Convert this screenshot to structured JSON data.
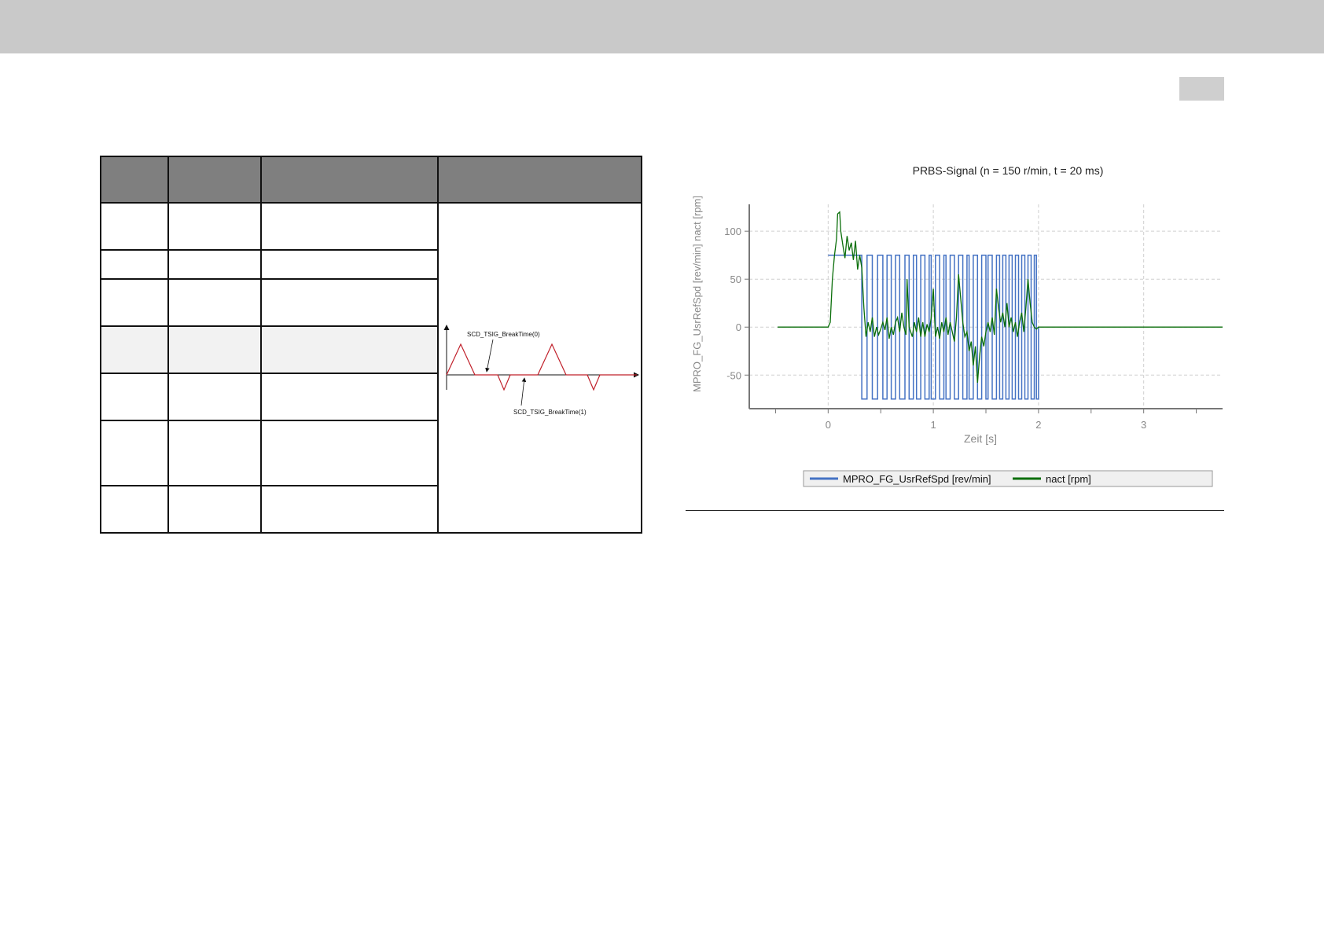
{
  "figure_labels": {
    "tsig_break_0": "SCD_TSIG_BreakTime(0)",
    "tsig_break_1": "SCD_TSIG_BreakTime(1)"
  },
  "chart_data": {
    "type": "line",
    "title": "PRBS-Signal (n = 150 r/min, t = 20 ms)",
    "xlabel": "Zeit [s]",
    "ylabel": "MPRO_FG_UsrRefSpd [rev/min]  nact [rpm]",
    "xlim": [
      -0.75,
      3.75
    ],
    "ylim": [
      -85,
      128
    ],
    "x_ticks": [
      0,
      1,
      2,
      3
    ],
    "y_ticks": [
      100,
      50,
      0,
      -50
    ],
    "grid": true,
    "legend_position": "bottom",
    "series": [
      {
        "name": "MPRO_FG_UsrRefSpd [rev/min]",
        "color": "#4472c4",
        "points": [
          [
            0,
            75
          ],
          [
            0.32,
            75
          ],
          [
            0.32,
            -75
          ],
          [
            0.37,
            -75
          ],
          [
            0.37,
            75
          ],
          [
            0.42,
            75
          ],
          [
            0.42,
            -75
          ],
          [
            0.47,
            -75
          ],
          [
            0.47,
            75
          ],
          [
            0.52,
            75
          ],
          [
            0.52,
            -75
          ],
          [
            0.56,
            -75
          ],
          [
            0.56,
            75
          ],
          [
            0.6,
            75
          ],
          [
            0.6,
            -75
          ],
          [
            0.64,
            -75
          ],
          [
            0.64,
            75
          ],
          [
            0.68,
            75
          ],
          [
            0.68,
            -75
          ],
          [
            0.73,
            -75
          ],
          [
            0.73,
            75
          ],
          [
            0.77,
            75
          ],
          [
            0.77,
            -75
          ],
          [
            0.81,
            -75
          ],
          [
            0.81,
            75
          ],
          [
            0.84,
            75
          ],
          [
            0.84,
            -75
          ],
          [
            0.88,
            -75
          ],
          [
            0.88,
            75
          ],
          [
            0.92,
            75
          ],
          [
            0.92,
            -75
          ],
          [
            0.96,
            -75
          ],
          [
            0.96,
            75
          ],
          [
            0.98,
            75
          ],
          [
            0.98,
            -75
          ],
          [
            1.02,
            -75
          ],
          [
            1.02,
            75
          ],
          [
            1.06,
            75
          ],
          [
            1.06,
            -75
          ],
          [
            1.1,
            -75
          ],
          [
            1.1,
            75
          ],
          [
            1.12,
            75
          ],
          [
            1.12,
            -75
          ],
          [
            1.16,
            -75
          ],
          [
            1.16,
            75
          ],
          [
            1.2,
            75
          ],
          [
            1.2,
            -75
          ],
          [
            1.24,
            -75
          ],
          [
            1.24,
            75
          ],
          [
            1.28,
            75
          ],
          [
            1.28,
            -75
          ],
          [
            1.32,
            -75
          ],
          [
            1.32,
            75
          ],
          [
            1.34,
            75
          ],
          [
            1.34,
            -75
          ],
          [
            1.38,
            -75
          ],
          [
            1.38,
            75
          ],
          [
            1.42,
            75
          ],
          [
            1.42,
            -75
          ],
          [
            1.46,
            -75
          ],
          [
            1.46,
            75
          ],
          [
            1.5,
            75
          ],
          [
            1.5,
            -75
          ],
          [
            1.52,
            -75
          ],
          [
            1.52,
            75
          ],
          [
            1.56,
            75
          ],
          [
            1.56,
            -75
          ],
          [
            1.6,
            -75
          ],
          [
            1.6,
            75
          ],
          [
            1.63,
            75
          ],
          [
            1.63,
            -75
          ],
          [
            1.66,
            -75
          ],
          [
            1.66,
            75
          ],
          [
            1.69,
            75
          ],
          [
            1.69,
            -75
          ],
          [
            1.72,
            -75
          ],
          [
            1.72,
            75
          ],
          [
            1.75,
            75
          ],
          [
            1.75,
            -75
          ],
          [
            1.78,
            -75
          ],
          [
            1.78,
            75
          ],
          [
            1.81,
            75
          ],
          [
            1.81,
            -75
          ],
          [
            1.84,
            -75
          ],
          [
            1.84,
            75
          ],
          [
            1.87,
            75
          ],
          [
            1.87,
            -75
          ],
          [
            1.9,
            -75
          ],
          [
            1.9,
            75
          ],
          [
            1.93,
            75
          ],
          [
            1.93,
            -75
          ],
          [
            1.96,
            -75
          ],
          [
            1.96,
            75
          ],
          [
            1.98,
            75
          ],
          [
            1.98,
            -75
          ],
          [
            2.0,
            -75
          ],
          [
            2.0,
            0
          ]
        ]
      },
      {
        "name": "nact [rpm]",
        "color": "#0a6e0a",
        "points": [
          [
            -0.48,
            0
          ],
          [
            -0.2,
            0
          ],
          [
            0,
            0
          ],
          [
            0.02,
            5
          ],
          [
            0.04,
            50
          ],
          [
            0.06,
            75
          ],
          [
            0.08,
            92
          ],
          [
            0.09,
            118
          ],
          [
            0.11,
            120
          ],
          [
            0.12,
            100
          ],
          [
            0.14,
            85
          ],
          [
            0.16,
            72
          ],
          [
            0.18,
            95
          ],
          [
            0.2,
            80
          ],
          [
            0.22,
            88
          ],
          [
            0.24,
            70
          ],
          [
            0.26,
            90
          ],
          [
            0.28,
            60
          ],
          [
            0.3,
            75
          ],
          [
            0.32,
            62
          ],
          [
            0.34,
            20
          ],
          [
            0.36,
            -10
          ],
          [
            0.38,
            5
          ],
          [
            0.4,
            -5
          ],
          [
            0.42,
            10
          ],
          [
            0.44,
            -10
          ],
          [
            0.46,
            0
          ],
          [
            0.48,
            -8
          ],
          [
            0.5,
            -2
          ],
          [
            0.52,
            5
          ],
          [
            0.54,
            -3
          ],
          [
            0.56,
            10
          ],
          [
            0.58,
            -12
          ],
          [
            0.6,
            0
          ],
          [
            0.62,
            -8
          ],
          [
            0.64,
            5
          ],
          [
            0.66,
            10
          ],
          [
            0.68,
            -5
          ],
          [
            0.7,
            15
          ],
          [
            0.72,
            0
          ],
          [
            0.74,
            -8
          ],
          [
            0.75,
            50
          ],
          [
            0.77,
            0
          ],
          [
            0.8,
            -10
          ],
          [
            0.82,
            5
          ],
          [
            0.84,
            -5
          ],
          [
            0.86,
            10
          ],
          [
            0.88,
            -10
          ],
          [
            0.9,
            5
          ],
          [
            0.92,
            -10
          ],
          [
            0.94,
            3
          ],
          [
            0.96,
            -5
          ],
          [
            0.98,
            10
          ],
          [
            1.0,
            40
          ],
          [
            1.02,
            -10
          ],
          [
            1.04,
            0
          ],
          [
            1.06,
            -12
          ],
          [
            1.08,
            5
          ],
          [
            1.1,
            -5
          ],
          [
            1.12,
            10
          ],
          [
            1.14,
            -8
          ],
          [
            1.16,
            5
          ],
          [
            1.18,
            -5
          ],
          [
            1.2,
            -15
          ],
          [
            1.22,
            10
          ],
          [
            1.24,
            55
          ],
          [
            1.26,
            30
          ],
          [
            1.28,
            5
          ],
          [
            1.3,
            -10
          ],
          [
            1.32,
            -5
          ],
          [
            1.34,
            -25
          ],
          [
            1.36,
            -15
          ],
          [
            1.38,
            -40
          ],
          [
            1.4,
            -20
          ],
          [
            1.42,
            -58
          ],
          [
            1.44,
            -30
          ],
          [
            1.46,
            -10
          ],
          [
            1.48,
            -20
          ],
          [
            1.5,
            -5
          ],
          [
            1.52,
            5
          ],
          [
            1.54,
            -5
          ],
          [
            1.56,
            10
          ],
          [
            1.58,
            -8
          ],
          [
            1.6,
            40
          ],
          [
            1.62,
            20
          ],
          [
            1.64,
            5
          ],
          [
            1.66,
            15
          ],
          [
            1.68,
            0
          ],
          [
            1.7,
            25
          ],
          [
            1.72,
            0
          ],
          [
            1.74,
            10
          ],
          [
            1.76,
            -5
          ],
          [
            1.78,
            5
          ],
          [
            1.8,
            -10
          ],
          [
            1.82,
            5
          ],
          [
            1.84,
            15
          ],
          [
            1.86,
            -5
          ],
          [
            1.88,
            20
          ],
          [
            1.9,
            50
          ],
          [
            1.92,
            25
          ],
          [
            1.94,
            5
          ],
          [
            1.96,
            0
          ],
          [
            1.98,
            -2
          ],
          [
            2.0,
            0
          ],
          [
            3.75,
            0
          ]
        ]
      }
    ]
  }
}
